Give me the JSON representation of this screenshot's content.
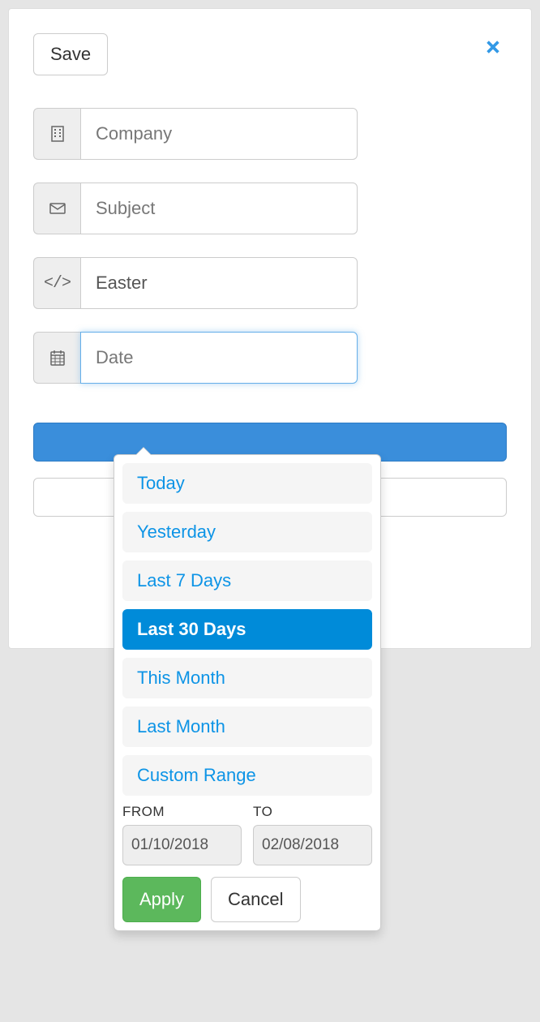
{
  "modal": {
    "save_label": "Save"
  },
  "fields": {
    "company": {
      "placeholder": "Company",
      "value": ""
    },
    "subject": {
      "placeholder": "Subject",
      "value": ""
    },
    "code": {
      "placeholder": "",
      "value": "Easter"
    },
    "date": {
      "placeholder": "Date",
      "value": ""
    }
  },
  "daterange": {
    "presets": [
      {
        "label": "Today",
        "active": false
      },
      {
        "label": "Yesterday",
        "active": false
      },
      {
        "label": "Last 7 Days",
        "active": false
      },
      {
        "label": "Last 30 Days",
        "active": true
      },
      {
        "label": "This Month",
        "active": false
      },
      {
        "label": "Last Month",
        "active": false
      },
      {
        "label": "Custom Range",
        "active": false
      }
    ],
    "from_label": "FROM",
    "to_label": "TO",
    "from_value": "01/10/2018",
    "to_value": "02/08/2018",
    "apply_label": "Apply",
    "cancel_label": "Cancel"
  }
}
